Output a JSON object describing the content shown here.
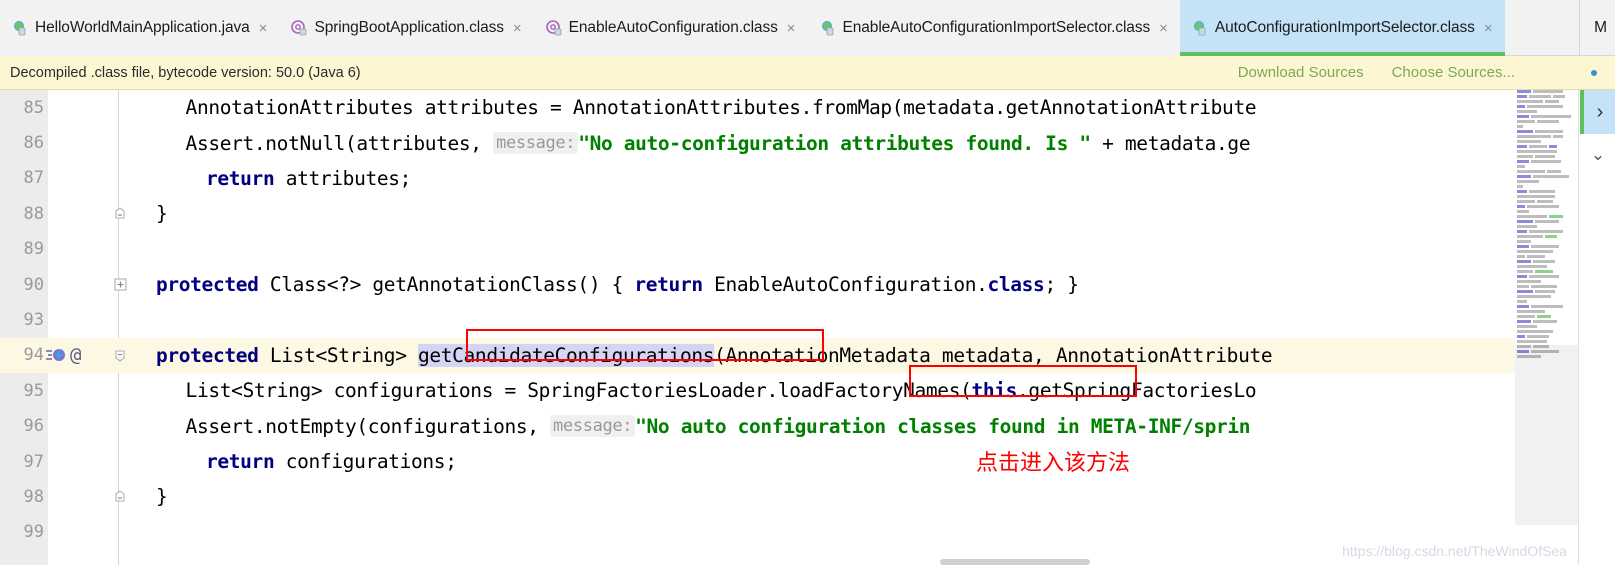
{
  "window": {
    "app": "IntelliJ IDEA",
    "watermark": "https://blog.csdn.net/TheWindOfSea"
  },
  "tabs": {
    "overflow_label": "M",
    "items": [
      {
        "label": "HelloWorldMainApplication.java",
        "icon": "java-file-icon",
        "close": "×",
        "active": false
      },
      {
        "label": "SpringBootApplication.class",
        "icon": "annotation-class-icon",
        "close": "×",
        "active": false
      },
      {
        "label": "EnableAutoConfiguration.class",
        "icon": "annotation-class-icon",
        "close": "×",
        "active": false
      },
      {
        "label": "EnableAutoConfigurationImportSelector.class",
        "icon": "class-file-icon",
        "close": "×",
        "active": false
      },
      {
        "label": "AutoConfigurationImportSelector.class",
        "icon": "class-file-icon",
        "close": "×",
        "active": true
      }
    ]
  },
  "notification": {
    "message": "Decompiled .class file, bytecode version: 50.0 (Java 6)",
    "download_sources": "Download Sources",
    "choose_sources": "Choose Sources...",
    "bg_color": "#fdf6d3",
    "link_color": "#7aab51"
  },
  "editor": {
    "current_line": 94,
    "lines": [
      {
        "num": "85",
        "indent": 4
      },
      {
        "num": "86",
        "indent": 4
      },
      {
        "num": "87",
        "indent": 4
      },
      {
        "num": "88",
        "indent": 1,
        "fold": "end"
      },
      {
        "num": "89",
        "indent": 0
      },
      {
        "num": "90",
        "indent": 1,
        "fold": "plus"
      },
      {
        "num": "93",
        "indent": 0
      },
      {
        "num": "94",
        "indent": 1,
        "fold": "minus",
        "icons": [
          "implementing-method-icon",
          "annotation-icon"
        ],
        "current": true
      },
      {
        "num": "95",
        "indent": 4
      },
      {
        "num": "96",
        "indent": 4
      },
      {
        "num": "97",
        "indent": 4
      },
      {
        "num": "98",
        "indent": 1,
        "fold": "end"
      },
      {
        "num": "99",
        "indent": 0
      }
    ],
    "code": {
      "l85": "    AnnotationAttributes attributes = AnnotationAttributes.fromMap(metadata.getAnnotationAttribute",
      "l86_a": "    Assert.notNull(attributes, ",
      "l86_hint": "message:",
      "l86_str": "\"No auto-configuration attributes found. Is \"",
      "l86_b": " + metadata.ge",
      "l87_kw": "return",
      "l87_rest": " attributes;",
      "l88": "}",
      "l90_kw1": "protected",
      "l90_mid": " Class<?> getAnnotationClass() { ",
      "l90_kw2": "return",
      "l90_rest": " EnableAutoConfiguration.",
      "l90_kw3": "class",
      "l90_tail": "; }",
      "l94_kw": "protected",
      "l94_mid": " List<String> ",
      "l94_sel": "getCandidateConfigurations",
      "l94_rest": "(AnnotationMetadata metadata, AnnotationAttribute",
      "l95_a": "    List<String> configurations = SpringFactoriesLoader.",
      "l95_box": "loadFactoryNames",
      "l95_b": "(",
      "l95_kw": "this",
      "l95_c": ".getSpringFactoriesLo",
      "l96_a": "    Assert.notEmpty(configurations, ",
      "l96_hint": "message:",
      "l96_str": "\"No auto configuration classes found in META-INF/sprin",
      "l97_kw": "return",
      "l97_rest": " configurations;",
      "l98": "}"
    },
    "annotations": {
      "chinese_note": "点击进入该方法",
      "note_color": "#ff0000",
      "box_color": "#ff0000"
    }
  },
  "right_gutter": {
    "next_button": "›",
    "collapse_button": "⌄"
  }
}
